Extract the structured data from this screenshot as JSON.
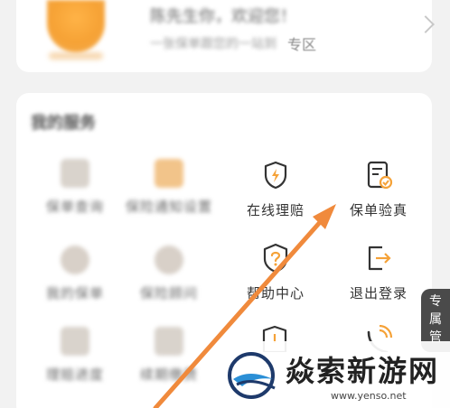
{
  "top_card": {
    "title": "陈先生你，欢迎您！",
    "subtitle": "一张保单跟您的一站到",
    "subtitle_tail": "专区"
  },
  "section": {
    "title": "我的服务"
  },
  "tiles": [
    {
      "label": "保单查询",
      "blurred": true
    },
    {
      "label": "保险通知设置",
      "blurred": true
    },
    {
      "label": "在线理赔",
      "blurred": false,
      "icon": "shield-lightning-icon"
    },
    {
      "label": "保单验真",
      "blurred": false,
      "icon": "policy-check-icon"
    },
    {
      "label": "我的保单",
      "blurred": true
    },
    {
      "label": "保险顾问",
      "blurred": true
    },
    {
      "label": "帮助中心",
      "blurred": false,
      "icon": "question-shield-icon"
    },
    {
      "label": "退出登录",
      "blurred": false,
      "icon": "logout-icon"
    },
    {
      "label": "理赔进度",
      "blurred": true
    },
    {
      "label": "续期缴费",
      "blurred": true
    }
  ],
  "side_tab": {
    "label": "专属管"
  },
  "watermark": {
    "title": "焱索新游网",
    "url": "www.yenso.net"
  },
  "colors": {
    "accent": "#f5a238",
    "arrow": "#f08a3c",
    "icon": "#333333"
  }
}
